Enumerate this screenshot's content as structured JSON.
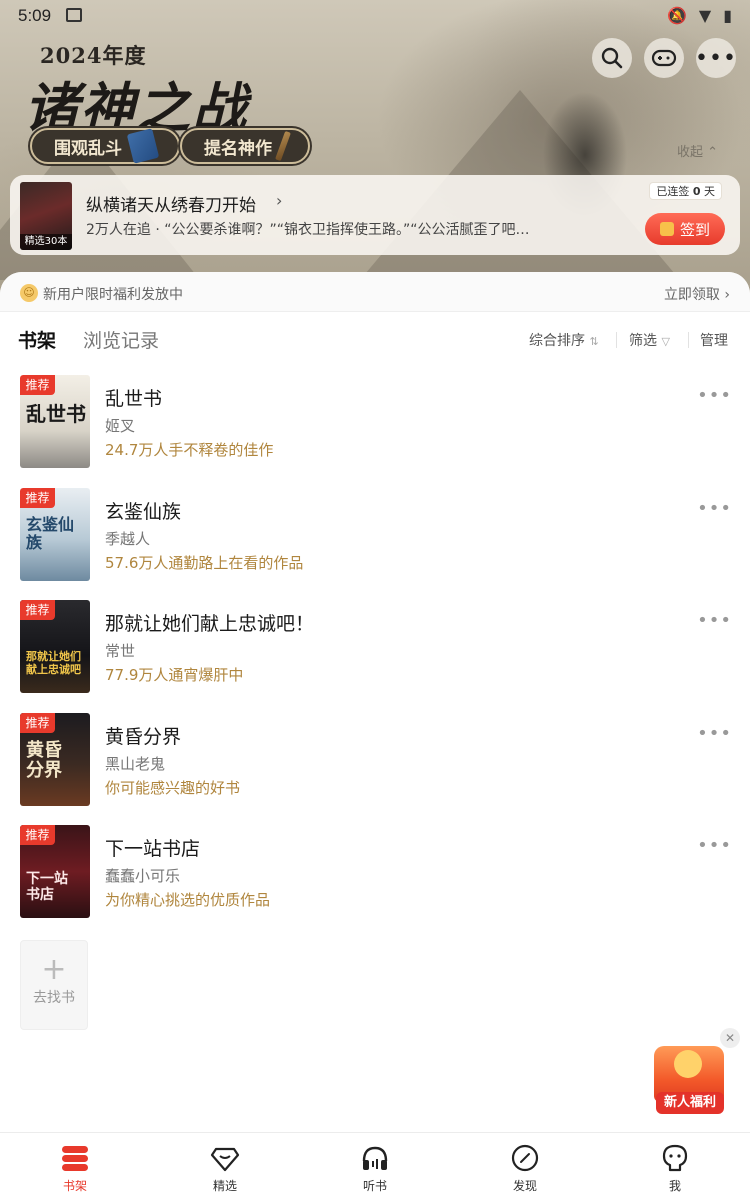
{
  "status_bar": {
    "time": "5:09"
  },
  "banner": {
    "event_year": "2024年度",
    "event_title": "诸神之战",
    "button_watch": "围观乱斗",
    "button_nominate": "提名神作",
    "collapse": "收起"
  },
  "recommendation": {
    "cover_tag": "精选30本",
    "title": "纵横诸天从绣春刀开始",
    "followers": "2万人在追",
    "quotes": "“公公要杀谁啊？”“锦衣卫指挥使王路。”“公公活腻歪了吧…",
    "streak_prefix": "已连签",
    "streak_days": "0",
    "streak_suffix": "天",
    "signin_label": "签到"
  },
  "promo": {
    "text": "新用户限时福利发放中",
    "claim_label": "立即领取"
  },
  "tabs": {
    "shelf": "书架",
    "history": "浏览记录",
    "sort": "综合排序",
    "filter": "筛选",
    "manage": "管理"
  },
  "books": [
    {
      "badge": "推荐",
      "title": "乱世书",
      "author": "姬叉",
      "desc": "24.7万人手不释卷的佳作",
      "cover_text": "乱世书"
    },
    {
      "badge": "推荐",
      "title": "玄鉴仙族",
      "author": "季越人",
      "desc": "57.6万人通勤路上在看的作品",
      "cover_text": "玄鉴仙族"
    },
    {
      "badge": "推荐",
      "title": "那就让她们献上忠诚吧！",
      "author": "常世",
      "desc": "77.9万人通宵爆肝中",
      "cover_text": "那就让她们献上忠诚吧"
    },
    {
      "badge": "推荐",
      "title": "黄昏分界",
      "author": "黑山老鬼",
      "desc": "你可能感兴趣的好书",
      "cover_text": "黄昏分界"
    },
    {
      "badge": "推荐",
      "title": "下一站书店",
      "author": "蠢蠢小可乐",
      "desc": "为你精心挑选的优质作品",
      "cover_text": "下一站书店"
    }
  ],
  "find_book": {
    "label": "去找书"
  },
  "newcomer_gift": {
    "label": "新人福利"
  },
  "bottom_nav": [
    {
      "label": "书架",
      "icon": "bookshelf-icon",
      "active": true
    },
    {
      "label": "精选",
      "icon": "diamond-icon",
      "active": false
    },
    {
      "label": "听书",
      "icon": "headphones-icon",
      "active": false
    },
    {
      "label": "发现",
      "icon": "compass-icon",
      "active": false
    },
    {
      "label": "我",
      "icon": "profile-icon",
      "active": false
    }
  ],
  "colors": {
    "accent_red": "#e8392b",
    "desc_gold": "#b0863e"
  }
}
